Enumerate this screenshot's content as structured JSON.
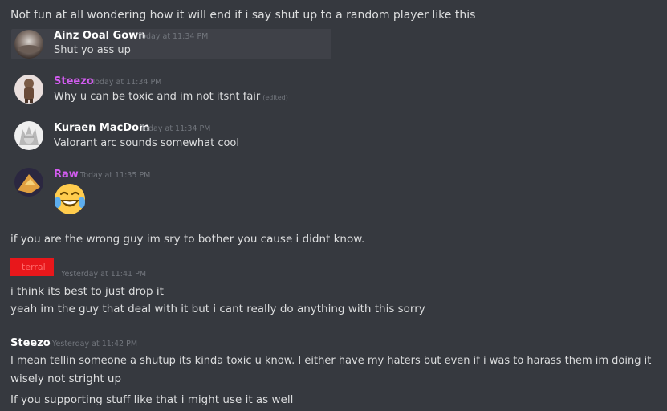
{
  "intro_text": "Not fun at all wondering how it will end if i say shut up to a random player like this",
  "quoted_messages": [
    {
      "username": "Ainz Ooal Gown",
      "timestamp": "Today at 11:34 PM",
      "text": "Shut yo ass up",
      "name_color": "#ffffff"
    },
    {
      "username": "Steezo",
      "timestamp": "Today at 11:34 PM",
      "text": "Why u can be toxic and im not itsnt fair",
      "edited": "(edited)",
      "name_color": "#d35cf0"
    },
    {
      "username": "Kuraen MacDom",
      "timestamp": "Today at 11:34 PM",
      "text": "Valorant arc sounds somewhat cool",
      "name_color": "#ffffff"
    },
    {
      "username": "Raw",
      "timestamp": "Today at 11:35 PM",
      "emoji": "face-with-tears-of-joy",
      "name_color": "#d35cf0"
    }
  ],
  "line_wrong_guy": "if you are the wrong guy im sry to bother you cause i didnt know.",
  "redacted_user": {
    "label": "terral",
    "timestamp": "Yesterday at 11:41 PM"
  },
  "line_drop_it": "i think its best to just drop it",
  "line_guy_that_deal": "yeah im the guy that deal with it but i cant really do anything with this sorry",
  "steezo_block": {
    "username": "Steezo",
    "timestamp": "Yesterday at 11:42 PM",
    "line1": "I mean tellin someone a shutup its kinda toxic u know. I either have my haters but even if i was to harass them im doing it",
    "line2": "wisely not stright up",
    "line3": "If you supporting stuff like that i might use it as well"
  },
  "colors": {
    "background": "#36393f",
    "highlight": "#3f4148",
    "text": "#dcddde",
    "timestamp": "#72767d",
    "redaction": "#e8171b"
  }
}
